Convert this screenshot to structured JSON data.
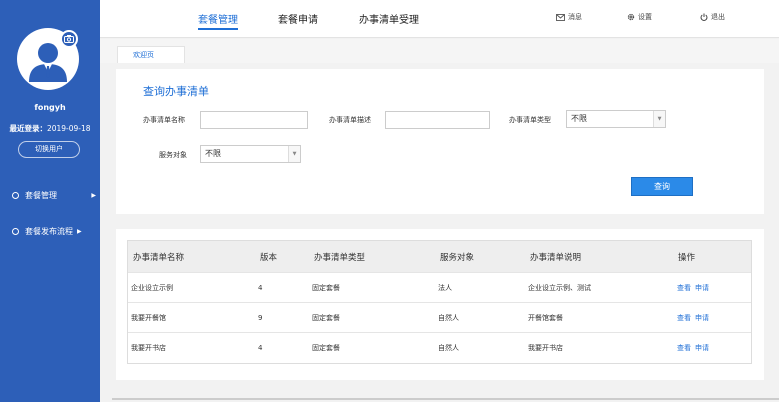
{
  "sidebar": {
    "username": "fongyh",
    "last_login_label": "最近登录：",
    "last_login_date": "2019-09-18",
    "switch_user": "切换用户",
    "nav": [
      {
        "label": "套餐管理"
      },
      {
        "label": "套餐发布流程"
      }
    ]
  },
  "header": {
    "tabs": [
      {
        "label": "套餐管理"
      },
      {
        "label": "套餐申请"
      },
      {
        "label": "办事清单受理"
      }
    ],
    "tools": {
      "messages": "消息",
      "settings": "设置",
      "logout": "退出"
    }
  },
  "subtab": {
    "label": "欢迎页"
  },
  "query": {
    "title": "查询办事清单",
    "name_label": "办事清单名称",
    "desc_label": "办事清单描述",
    "type_label": "办事清单类型",
    "type_value": "不限",
    "target_label": "服务对象",
    "target_value": "不限",
    "submit": "查询"
  },
  "table": {
    "headers": [
      "办事清单名称",
      "版本",
      "办事清单类型",
      "服务对象",
      "办事清单说明",
      "操作"
    ],
    "rows": [
      {
        "name": "企业设立示例",
        "version": "4",
        "type": "固定套餐",
        "target": "法人",
        "desc": "企业设立示例、测试"
      },
      {
        "name": "我要开餐馆",
        "version": "9",
        "type": "固定套餐",
        "target": "自然人",
        "desc": "开餐馆套餐"
      },
      {
        "name": "我要开书店",
        "version": "4",
        "type": "固定套餐",
        "target": "自然人",
        "desc": "我要开书店"
      }
    ],
    "op_view": "查看",
    "op_apply": "申请"
  },
  "colors": {
    "sidebar": "#2d5fb8",
    "accent": "#1f6fd6",
    "button": "#2b8ae8"
  }
}
